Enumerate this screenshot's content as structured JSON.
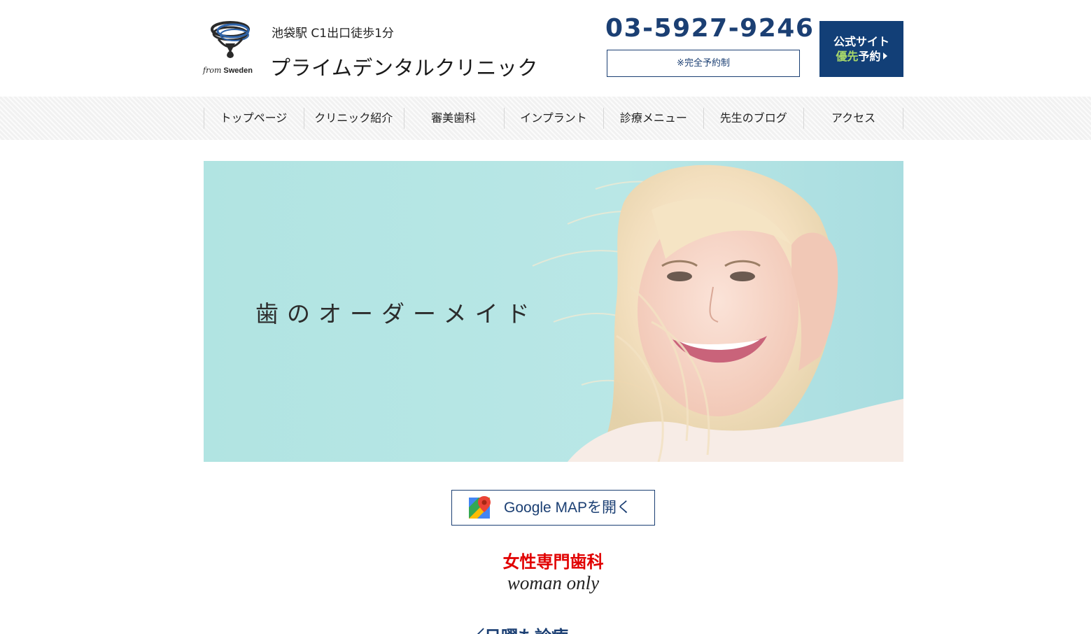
{
  "header": {
    "logo_tag_from": "from",
    "logo_tag_sweden": "Sweden",
    "station": "池袋駅 C1出口徒歩1分",
    "clinic_name": "プライムデンタルクリニック",
    "phone": "03-5927-9246",
    "reserve_note": "※完全予約制",
    "official_btn": {
      "line1": "公式サイト",
      "line2_accent": "優先",
      "line2_rest": "予約"
    }
  },
  "nav": {
    "items": [
      "トップページ",
      "クリニック紹介",
      "審美歯科",
      "インプラント",
      "診療メニュー",
      "先生のブログ",
      "アクセス"
    ]
  },
  "hero": {
    "caption": "歯のオーダーメイド"
  },
  "map_button": {
    "label": "Google MAPを開く"
  },
  "feature": {
    "title": "女性専門歯科",
    "subtitle": "woman only"
  },
  "next_heading": "／日曜も診療",
  "colors": {
    "navy": "#1b3f73",
    "button_bg": "#123f77",
    "accent_green": "#a8d86a",
    "red": "#e10000",
    "hero_bg": "#b3e5e3"
  },
  "icons": {
    "logo": "swedish-ribbon-logo",
    "map": "google-maps-icon",
    "arrow": "triangle-right-icon"
  }
}
